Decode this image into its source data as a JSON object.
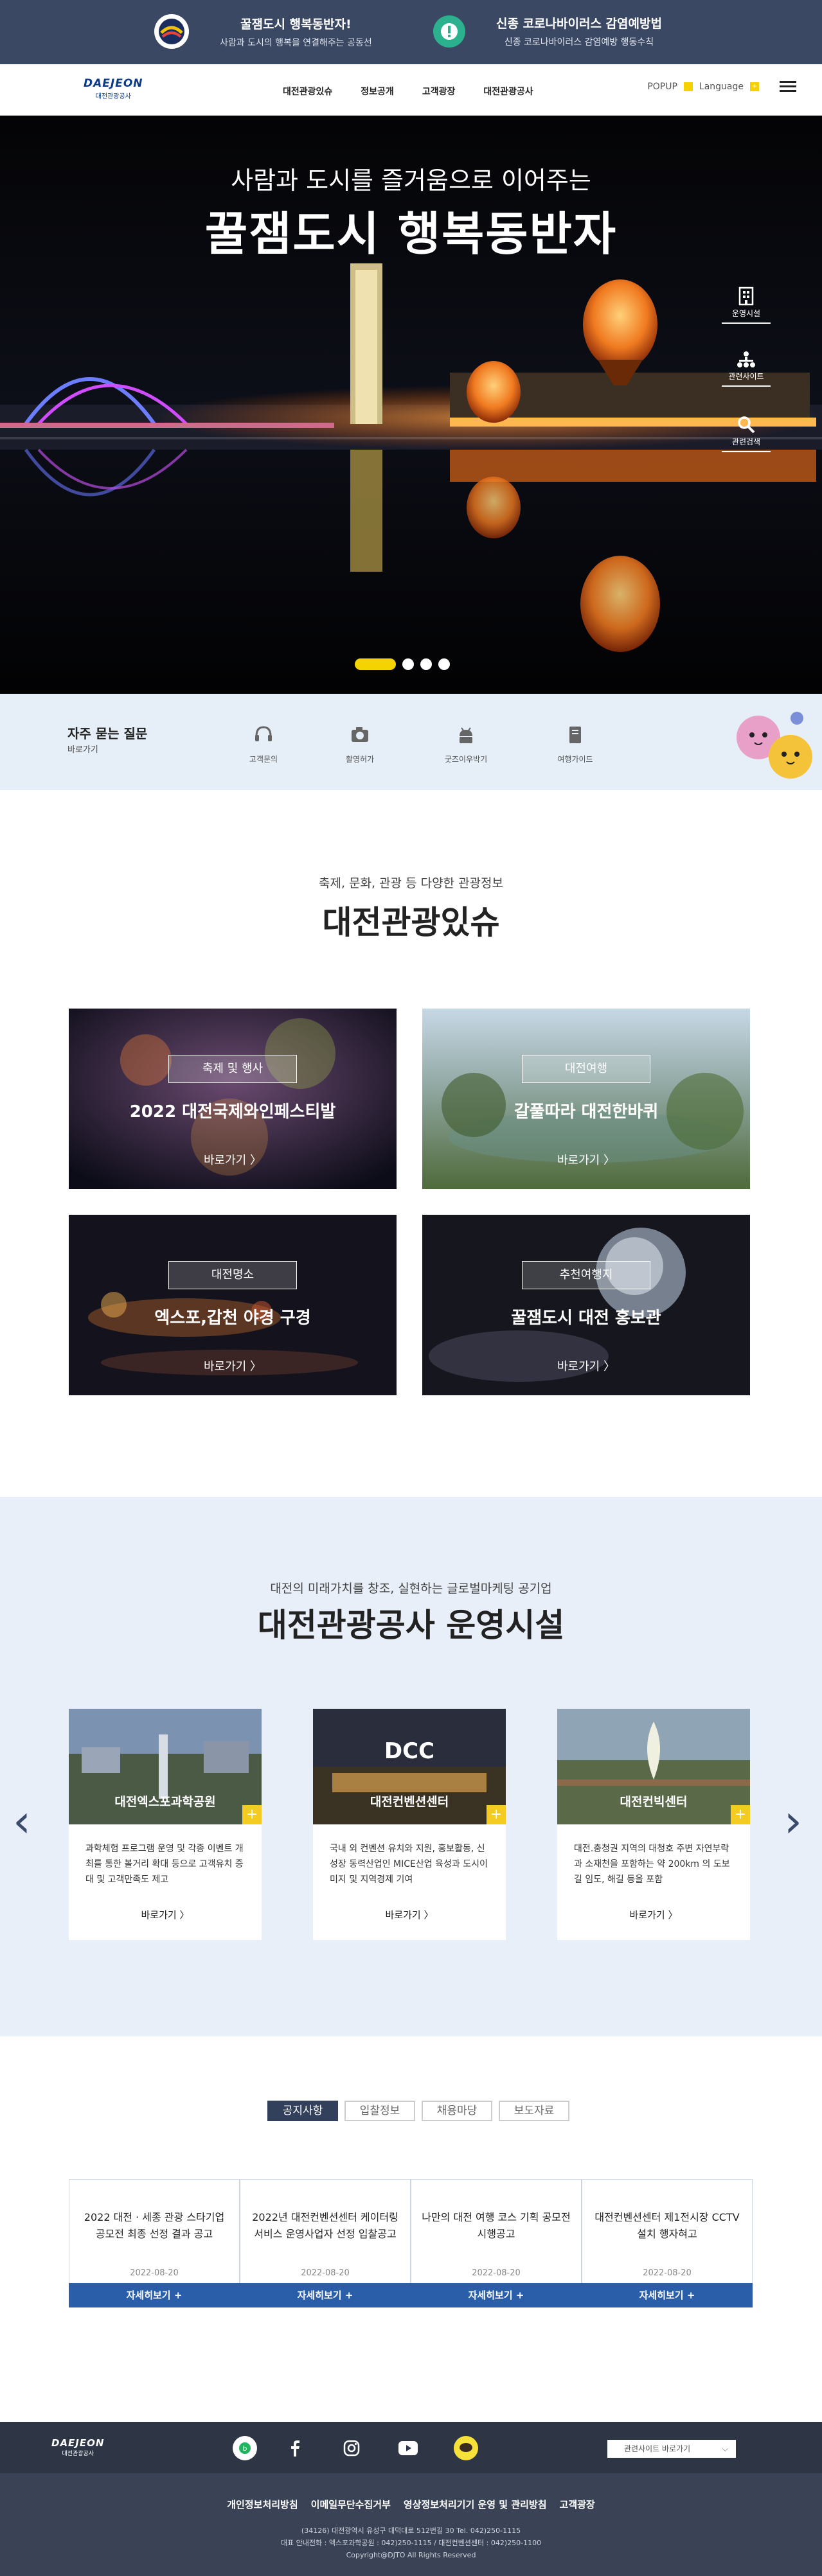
{
  "top_banner": {
    "left": {
      "title": "꿀잼도시 행복동반자!",
      "subtitle": "사람과 도시의 행복을 연결해주는 공동선"
    },
    "right": {
      "title": "신종 코로나바이러스 감염예방법",
      "subtitle": "신종 코로나바이러스 감염예방 행동수칙"
    }
  },
  "header": {
    "logo": {
      "text": "DAEJEON",
      "sub": "대전관광공사"
    },
    "nav": [
      "대전관광있슈",
      "정보공개",
      "고객광장",
      "대전관광공사"
    ],
    "popup": "POPUP",
    "language": "Language"
  },
  "hero": {
    "line1": "사람과 도시를 즐거움으로 이어주는",
    "line2": "꿀잼도시 행복동반자",
    "quick_links": [
      {
        "label": "운영시설",
        "icon": "building-icon"
      },
      {
        "label": "관련사이트",
        "icon": "sitemap-icon"
      },
      {
        "label": "관련검색",
        "icon": "search-icon"
      }
    ],
    "slides": 4,
    "active_slide": 1
  },
  "faq": {
    "title": "자주 묻는 질문",
    "link": "바로가기",
    "items": [
      {
        "label": "고객문의",
        "icon": "headset-icon"
      },
      {
        "label": "촬영허가",
        "icon": "camera-icon"
      },
      {
        "label": "굿즈이우박기",
        "icon": "android-icon"
      },
      {
        "label": "여행가이드",
        "icon": "guide-icon"
      }
    ]
  },
  "issue": {
    "subtitle": "축제, 문화, 관광 등 다양한 관광정보",
    "title": "대전관광있슈",
    "cards": [
      {
        "tag": "축제 및 행사",
        "title": "2022 대전국제와인페스티발",
        "link": "바로가기"
      },
      {
        "tag": "대전여행",
        "title": "갈풀따라 대전한바퀴",
        "link": "바로가기"
      },
      {
        "tag": "대전명소",
        "title": "엑스포,갑천 야경 구경",
        "link": "바로가기"
      },
      {
        "tag": "추천여행지",
        "title": "꿀잼도시 대전 홍보관",
        "link": "바로가기"
      }
    ]
  },
  "facility": {
    "subtitle": "대전의 미래가치를 창조, 실현하는 글로벌마케팅 공기업",
    "title": "대전관광공사 운영시설",
    "items": [
      {
        "name": "대전엑스포과학공원",
        "desc": "과학체험 프로그램 운영 및 각종 이벤트 개최를 통한 볼거리 확대 등으로 고객유치 증대 및 고객만족도 제고",
        "link": "바로가기"
      },
      {
        "name": "대전컨벤션센터",
        "desc": "국내 외 컨벤션 유치와 지원, 홍보활동, 신성장 동력산업인 MICE산업 육성과 도시이미지 및 지역경제 기여",
        "link": "바로가기",
        "logo": "DCC"
      },
      {
        "name": "대전컨빅센터",
        "desc": "대전.충청권 지역의 대청호 주변 자연부락과 소재천을 포함하는 약 200km 의 도보길 임도, 해길 등을 포함",
        "link": "바로가기"
      }
    ]
  },
  "notice": {
    "tabs": [
      "공지사항",
      "입찰정보",
      "채용마당",
      "보도자료"
    ],
    "items": [
      {
        "title": "2022 대전 · 세종 관광 스타기업 공모전 최종 선정 결과 공고",
        "date": "2022-08-20",
        "button": "자세히보기 +"
      },
      {
        "title": "2022년 대전컨벤션센터 케이터링 서비스 운영사업자 선정 입찰공고",
        "date": "2022-08-20",
        "button": "자세히보기 +"
      },
      {
        "title": "나만의 대전 여행 코스 기획 공모전 시행공고",
        "date": "2022-08-20",
        "button": "자세히보기 +"
      },
      {
        "title": "대전컨벤션센터 제1전시장 CCTV 설치 행자혀고",
        "date": "2022-08-20",
        "button": "자세히보기 +"
      }
    ]
  },
  "footer": {
    "logo": {
      "text": "DAEJEON",
      "sub": "대전관광공사"
    },
    "sns": [
      "blog-icon",
      "facebook-icon",
      "instagram-icon",
      "youtube-icon",
      "kakao-icon"
    ],
    "family_site": "관련사이트 바로가기",
    "links": [
      "개인정보처리방침",
      "이메일무단수집거부",
      "영상정보처리기기 운영 및 관리방침",
      "고객광장"
    ],
    "info": [
      "(34126) 대전광역시 유성구 대덕대로 512번길 30 Tel. 042)250-1115",
      "대표 안내전화 : 엑스포과학공원 : 042)250-1115 / 대전컨벤션센터 : 042)250-1100",
      "Copyright@DJTO All Rights Reserved"
    ]
  }
}
